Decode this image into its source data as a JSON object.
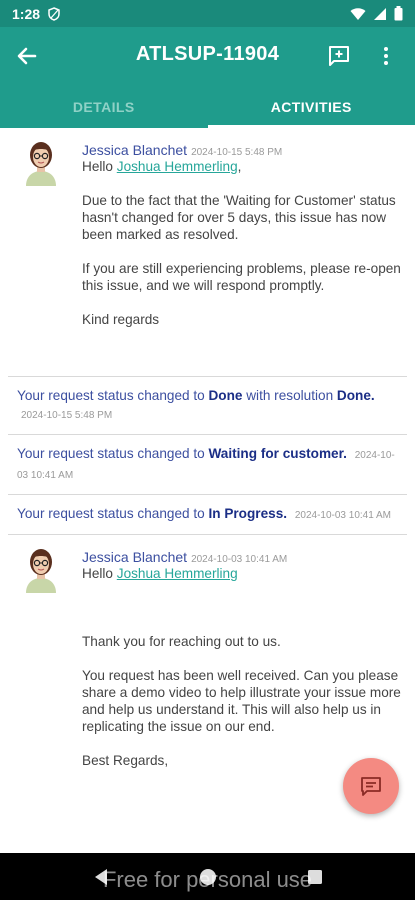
{
  "status_bar": {
    "time": "1:28"
  },
  "app_bar": {
    "title": "ATLSUP-11904"
  },
  "tabs": [
    {
      "label": "DETAILS",
      "active": false
    },
    {
      "label": "ACTIVITIES",
      "active": true
    }
  ],
  "comments": [
    {
      "author": "Jessica Blanchet",
      "timestamp": "2024-10-15 5:48 PM",
      "greeting": "Hello",
      "mention": "Joshua Hemmerling",
      "greeting_suffix": ",",
      "paragraphs": [
        "Due to the fact that the 'Waiting for Customer' status hasn't changed for over 5 days, this issue has now been marked as resolved.",
        "If you are still experiencing problems, please re-open this issue, and we will respond promptly.",
        "Kind regards"
      ]
    },
    {
      "author": "Jessica Blanchet",
      "timestamp": "2024-10-03 10:41 AM",
      "greeting": "Hello",
      "mention": "Joshua Hemmerling",
      "greeting_suffix": "",
      "paragraphs": [
        "Thank you for reaching out to us.",
        "You request has been well received. Can you please share a demo video to help illustrate your issue more and help us understand it. This will also help us in replicating the issue on our end.",
        "Best Regards,"
      ]
    }
  ],
  "status_changes": [
    {
      "prefix": "Your request status changed to",
      "value": "Done",
      "suffix": "with resolution",
      "value2": "Done.",
      "timestamp": "2024-10-15 5:48 PM"
    },
    {
      "prefix": "Your request status changed to",
      "value": "Waiting for customer.",
      "timestamp": "2024-10-03 10:41 AM"
    },
    {
      "prefix": "Your request status changed to",
      "value": "In Progress.",
      "timestamp": "2024-10-03 10:41 AM"
    }
  ],
  "watermark": "Free for personal use",
  "colors": {
    "app_bar": "#1f9c8c",
    "status_bar": "#1a8a7b",
    "accent_link": "#26a69a",
    "author": "#3c4fa0",
    "status_value": "#1b2e86",
    "fab": "#f48a82"
  },
  "icons": {
    "back": "arrow-left-icon",
    "add_comment": "add-comment-icon",
    "more": "more-vertical-icon",
    "fab": "chat-bubble-icon"
  }
}
